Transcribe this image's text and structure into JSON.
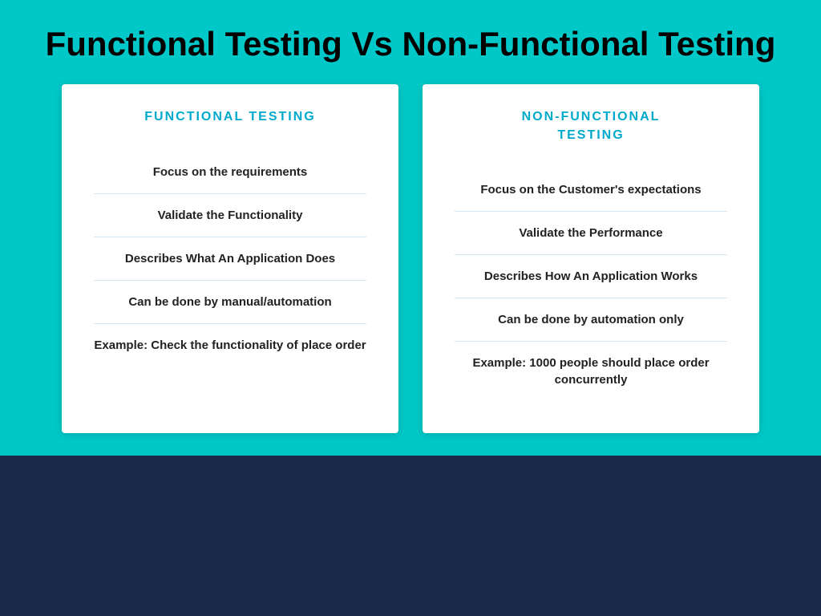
{
  "page": {
    "title": "Functional Testing Vs Non-Functional Testing",
    "background_color": "#00C8C8",
    "bottom_color": "#1A2A4A"
  },
  "left_card": {
    "title": "FUNCTIONAL TESTING",
    "items": [
      "Focus on the requirements",
      "Validate the Functionality",
      "Describes What An Application Does",
      "Can be done by manual/automation",
      "Example: Check the functionality of place order"
    ]
  },
  "right_card": {
    "title": "NON-FUNCTIONAL\nTESTING",
    "items": [
      "Focus on the Customer's expectations",
      "Validate the Performance",
      "Describes How An Application Works",
      "Can be done by automation only",
      "Example: 1000 people should place order concurrently"
    ]
  }
}
